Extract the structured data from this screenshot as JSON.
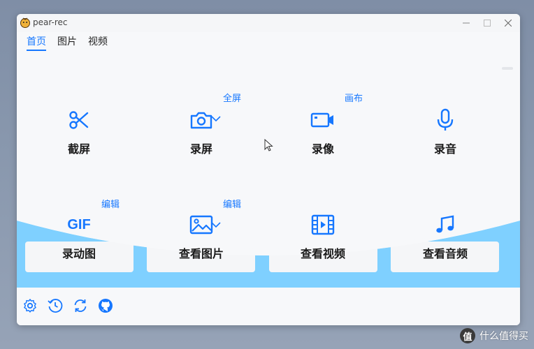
{
  "window": {
    "title": "pear-rec",
    "accent": "#1677ff"
  },
  "tabs": [
    {
      "label": "首页",
      "active": true
    },
    {
      "label": "图片",
      "active": false
    },
    {
      "label": "视频",
      "active": false
    }
  ],
  "main": {
    "row1": [
      {
        "label": "截屏",
        "icon": "scissors-icon"
      },
      {
        "label": "录屏",
        "icon": "camera-icon",
        "sublink": "全屏"
      },
      {
        "label": "录像",
        "icon": "video-camera-icon",
        "sublink": "画布"
      },
      {
        "label": "录音",
        "icon": "microphone-icon"
      }
    ],
    "row2": [
      {
        "label": "录动图",
        "icon": "gif-icon",
        "icon_text": "GIF",
        "sublink": "编辑"
      },
      {
        "label": "查看图片",
        "icon": "image-icon",
        "sublink": "编辑"
      },
      {
        "label": "查看视频",
        "icon": "film-icon"
      },
      {
        "label": "查看音频",
        "icon": "music-note-icon"
      }
    ]
  },
  "footer": {
    "icons": [
      "settings-icon",
      "history-icon",
      "refresh-icon",
      "github-icon"
    ]
  },
  "watermark": {
    "logo": "值",
    "text": "什么值得买"
  }
}
